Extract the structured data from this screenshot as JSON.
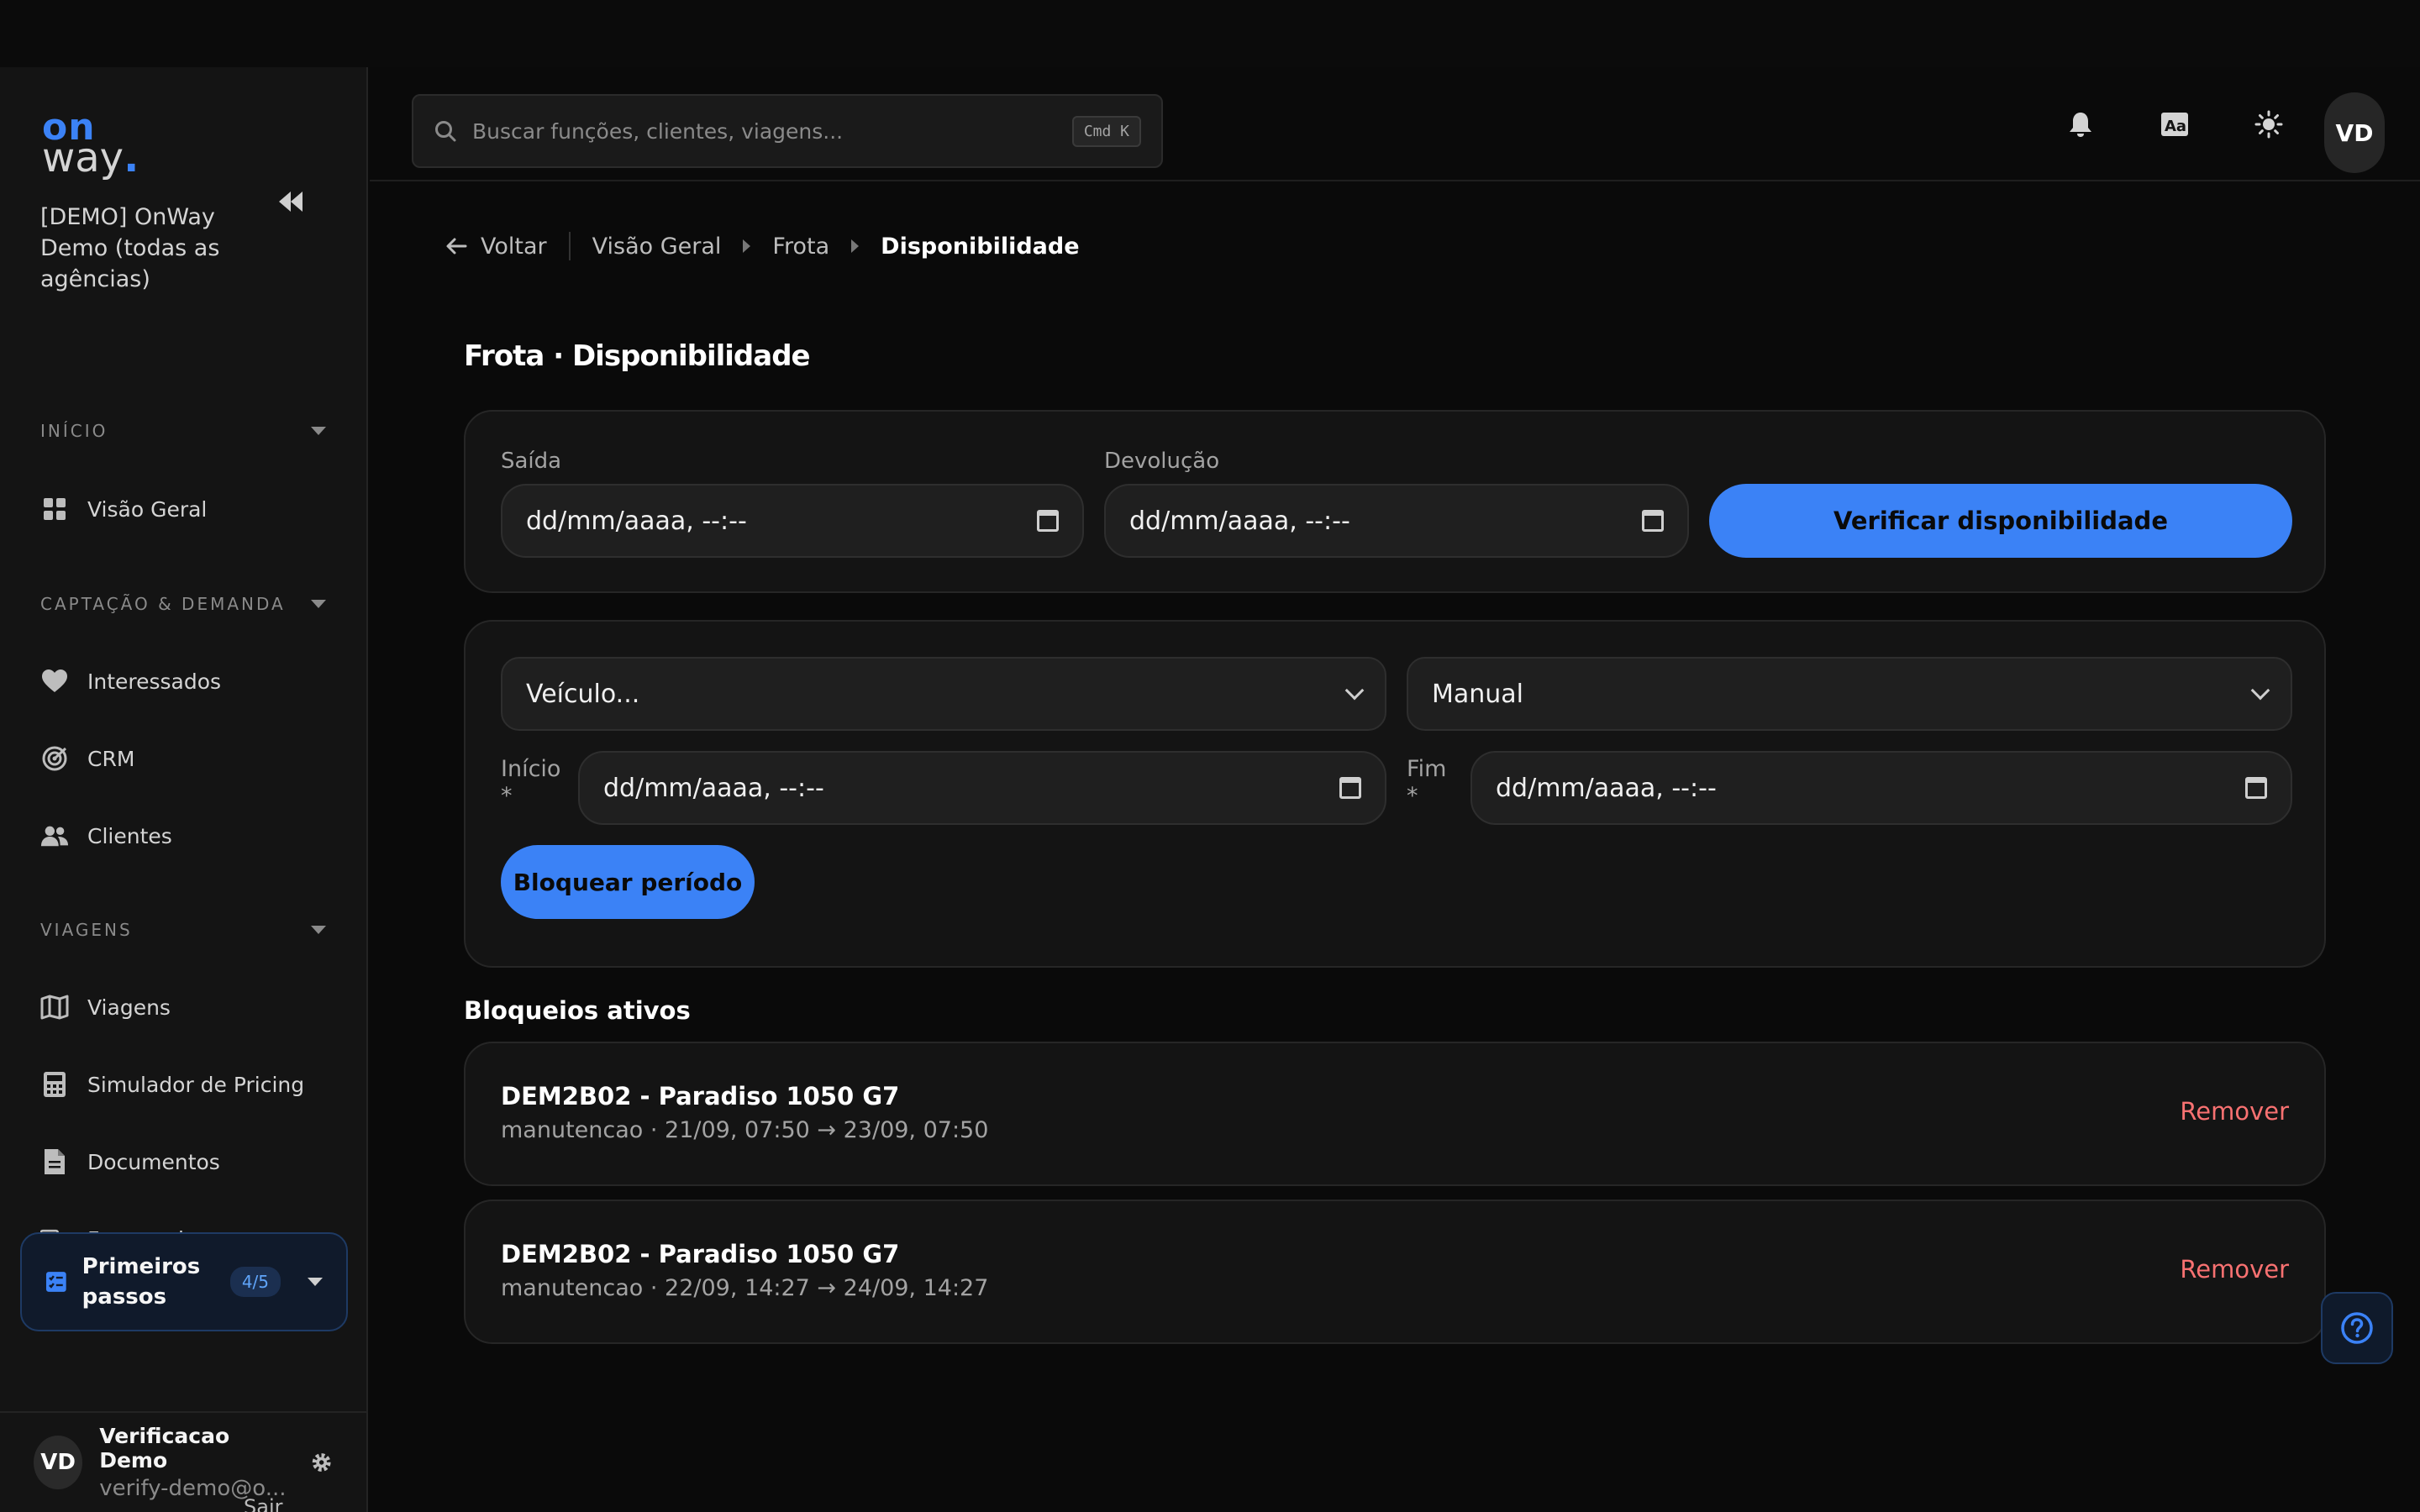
{
  "brand": {
    "logo_top": "on",
    "logo_bottom": "way",
    "logo_dot": ".",
    "accent": "#3b82f6"
  },
  "sidebar": {
    "org_name": "[DEMO] OnWay Demo (todas as agências)",
    "sections": [
      {
        "title": "INÍCIO",
        "items": [
          {
            "label": "Visão Geral",
            "icon": "grid-icon"
          }
        ]
      },
      {
        "title": "CAPTAÇÃO & DEMANDA",
        "items": [
          {
            "label": "Interessados",
            "icon": "heart-icon"
          },
          {
            "label": "CRM",
            "icon": "target-icon"
          },
          {
            "label": "Clientes",
            "icon": "users-icon"
          }
        ]
      },
      {
        "title": "VIAGENS",
        "items": [
          {
            "label": "Viagens",
            "icon": "map-icon"
          },
          {
            "label": "Simulador de Pricing",
            "icon": "calculator-icon"
          },
          {
            "label": "Documentos",
            "icon": "document-icon"
          },
          {
            "label": "Fornecedores",
            "icon": "truck-icon"
          }
        ]
      }
    ],
    "onboarding": {
      "label": "Primeiros passos",
      "progress": "4/5"
    },
    "user": {
      "initials": "VD",
      "name": "Verificacao Demo",
      "email": "verify-demo@o..."
    },
    "logout_label": "Sair"
  },
  "header": {
    "search_placeholder": "Buscar funções, clientes, viagens...",
    "shortcut": "Cmd K",
    "avatar_initials": "VD"
  },
  "breadcrumb": {
    "back": "Voltar",
    "items": [
      "Visão Geral",
      "Frota",
      "Disponibilidade"
    ]
  },
  "page": {
    "title": "Frota · Disponibilidade",
    "availability": {
      "departure_label": "Saída",
      "departure_value": "dd/mm/aaaa, --:--",
      "return_label": "Devolução",
      "return_value": "dd/mm/aaaa, --:--",
      "check_button": "Verificar disponibilidade"
    },
    "block_form": {
      "vehicle_select": "Veículo...",
      "mode_select": "Manual",
      "start_label": "Início",
      "start_required": "*",
      "start_value": "dd/mm/aaaa, --:--",
      "end_label": "Fim",
      "end_required": "*",
      "end_value": "dd/mm/aaaa, --:--",
      "block_button": "Bloquear período"
    },
    "active_blocks": {
      "title": "Bloqueios ativos",
      "items": [
        {
          "vehicle": "DEM2B02 - Paradiso 1050 G7",
          "detail": "manutencao · 21/09, 07:50 → 23/09, 07:50",
          "action": "Remover"
        },
        {
          "vehicle": "DEM2B02 - Paradiso 1050 G7",
          "detail": "manutencao · 22/09, 14:27 → 24/09, 14:27",
          "action": "Remover"
        }
      ]
    }
  }
}
